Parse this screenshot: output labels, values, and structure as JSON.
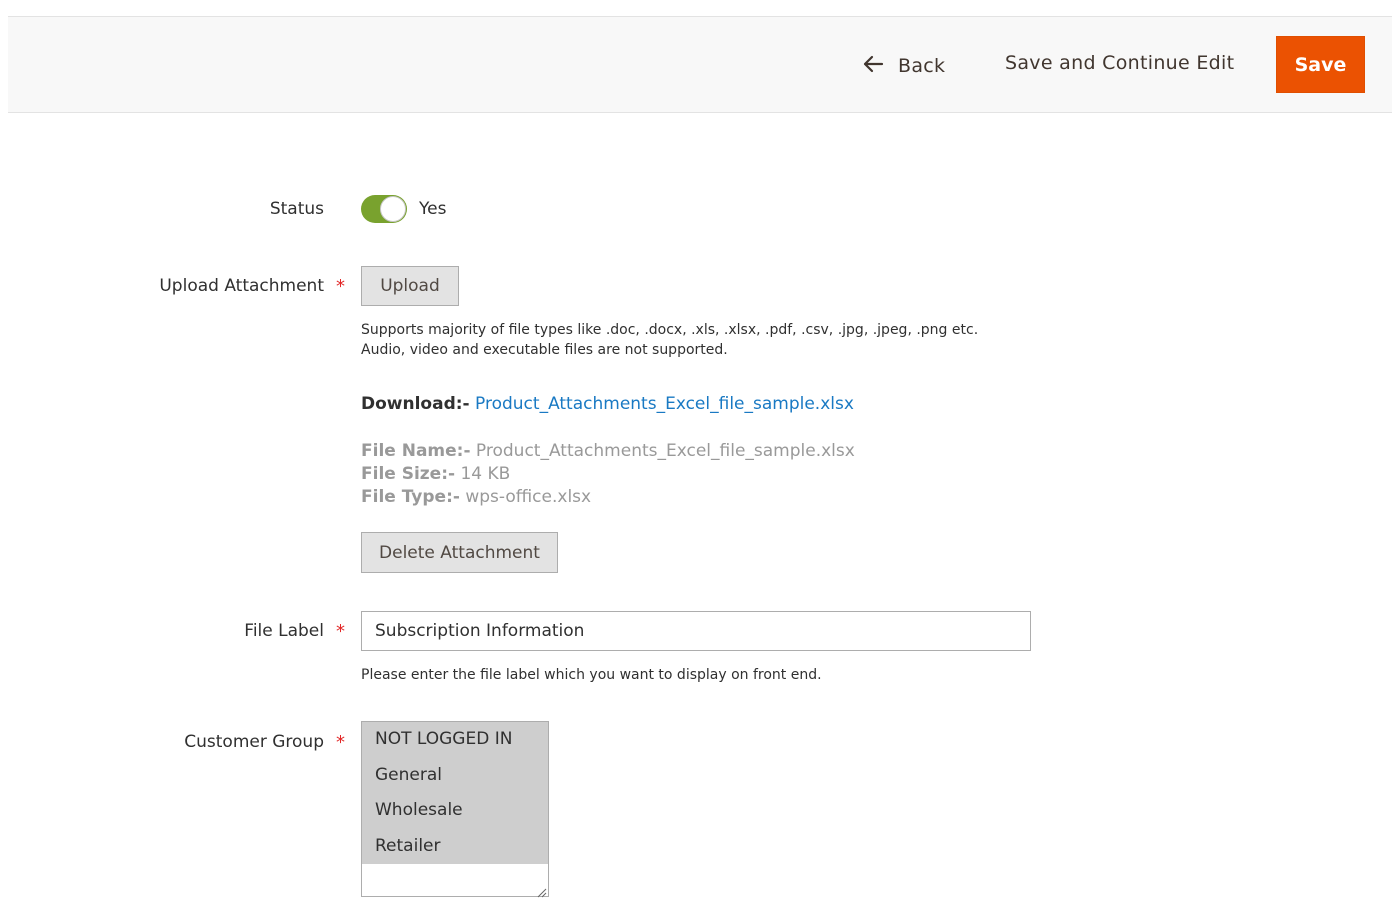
{
  "toolbar": {
    "back_label": "Back",
    "save_continue_label": "Save and Continue Edit",
    "save_label": "Save"
  },
  "status": {
    "label": "Status",
    "value_text": "Yes",
    "enabled": true
  },
  "upload": {
    "label": "Upload Attachment",
    "required_mark": "*",
    "button_label": "Upload",
    "note": "Supports majority of file types like .doc, .docx, .xls, .xlsx, .pdf, .csv, .jpg, .jpeg, .png etc. Audio, video and executable files are not supported.",
    "download_prefix": "Download:-",
    "download_link": "Product_Attachments_Excel_file_sample.xlsx",
    "file_name_label": "File Name:-",
    "file_name_value": "Product_Attachments_Excel_file_sample.xlsx",
    "file_size_label": "File Size:-",
    "file_size_value": "14 KB",
    "file_type_label": "File Type:-",
    "file_type_value": "wps-office.xlsx",
    "delete_button_label": "Delete Attachment"
  },
  "file_label": {
    "label": "File Label",
    "required_mark": "*",
    "value": "Subscription Information",
    "note": "Please enter the file label which you want to display on front end."
  },
  "customer_group": {
    "label": "Customer Group",
    "required_mark": "*",
    "options": [
      "NOT LOGGED IN",
      "General",
      "Wholesale",
      "Retailer"
    ]
  },
  "colors": {
    "accent": "#eb5202",
    "toggle_on": "#79a22e",
    "link": "#1979c3",
    "required": "#e22626"
  },
  "icons": {
    "back": "arrow-left-icon",
    "resize": "resize-grip-icon"
  }
}
